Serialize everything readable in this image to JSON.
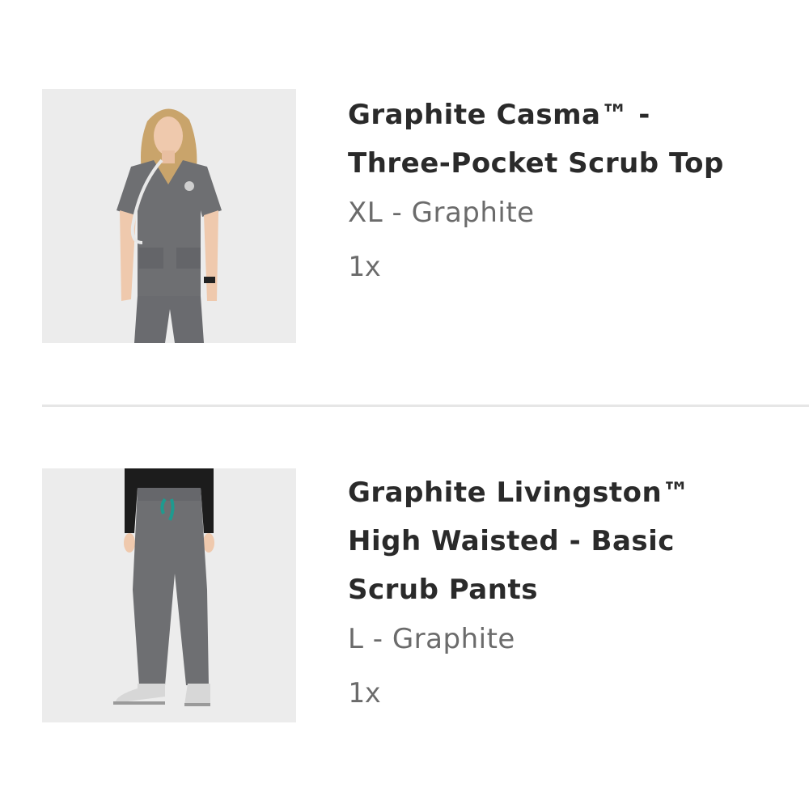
{
  "order_items": [
    {
      "title_line1": "Graphite Casma™ -",
      "title_line2": "Three-Pocket Scrub Top",
      "variant": "XL - Graphite",
      "quantity": "1x",
      "image_icon": "scrub-top-photo"
    },
    {
      "title_line1": "Graphite Livingston™",
      "title_line2": "High Waisted - Basic",
      "title_line3": "Scrub Pants",
      "variant": "L - Graphite",
      "quantity": "1x",
      "image_icon": "scrub-pants-photo"
    }
  ],
  "colors": {
    "garment": "#6e6f72",
    "drawstring": "#1f9a8f",
    "divider": "#e6e6e6"
  }
}
